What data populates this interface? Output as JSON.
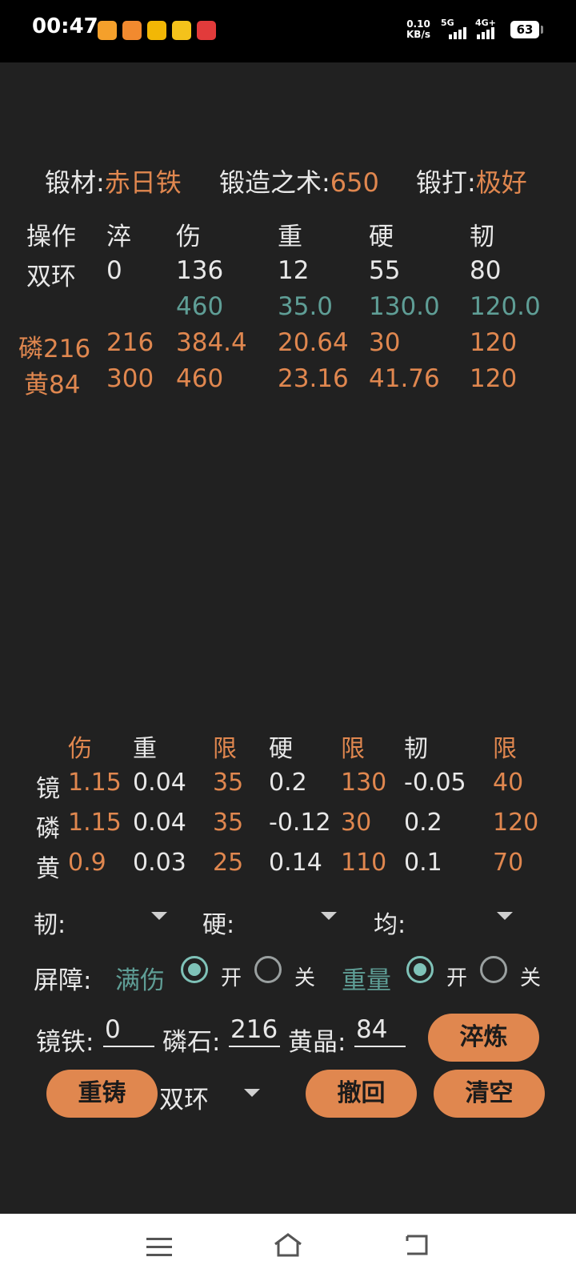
{
  "status_bar": {
    "time": "00:47",
    "net_speed_value": "0.10",
    "net_speed_unit": "KB/s",
    "net1": "5G",
    "net2": "4G+",
    "battery": "63",
    "icons": [
      "app-icon-orange",
      "app-icon-orange-2",
      "app-icon-yellow",
      "app-icon-mail",
      "app-icon-red"
    ]
  },
  "header": {
    "material_label": "锻材:",
    "material_value": "赤日铁",
    "skill_label": "锻造之术:",
    "skill_value": "650",
    "forge_label": "锻打:",
    "forge_value": "极好"
  },
  "table": {
    "headers": [
      "操作",
      "淬",
      "伤",
      "重",
      "硬",
      "韧"
    ],
    "row_base": [
      "双环",
      "0",
      "136",
      "12",
      "55",
      "80"
    ],
    "row_limit": [
      "",
      "",
      "460",
      "35.0",
      "130.0",
      "120.0"
    ],
    "row_step1": [
      "磷216",
      "216",
      "384.4",
      "20.64",
      "30",
      "120"
    ],
    "row_step2": [
      "黄84",
      "300",
      "460",
      "23.16",
      "41.76",
      "120"
    ]
  },
  "coef": {
    "headers": [
      "伤",
      "重",
      "限",
      "硬",
      "限",
      "韧",
      "限"
    ],
    "rows": [
      {
        "name": "镜",
        "values": [
          "1.15",
          "0.04",
          "35",
          "0.2",
          "130",
          "-0.05",
          "40"
        ]
      },
      {
        "name": "磷",
        "values": [
          "1.15",
          "0.04",
          "35",
          "-0.12",
          "30",
          "0.2",
          "120"
        ]
      },
      {
        "name": "黄",
        "values": [
          "0.9",
          "0.03",
          "25",
          "0.14",
          "110",
          "0.1",
          "70"
        ]
      }
    ]
  },
  "dropdowns": {
    "toughness_label": "韧:",
    "hardness_label": "硬:",
    "uniform_label": "均:"
  },
  "barrier": {
    "label": "屏障:",
    "full_damage": "满伤",
    "weight": "重量",
    "on": "开",
    "off": "关"
  },
  "inputs": {
    "mirror_label": "镜铁:",
    "mirror_value": "0",
    "phosphor_label": "磷石:",
    "phosphor_value": "216",
    "yellow_label": "黄晶:",
    "yellow_value": "84"
  },
  "buttons": {
    "quench": "淬炼",
    "recast": "重铸",
    "weapon_select": "双环",
    "undo": "撤回",
    "clear": "清空"
  },
  "colors": {
    "accent": "#e0874f",
    "teal": "#5f9e96",
    "background": "#212121"
  }
}
